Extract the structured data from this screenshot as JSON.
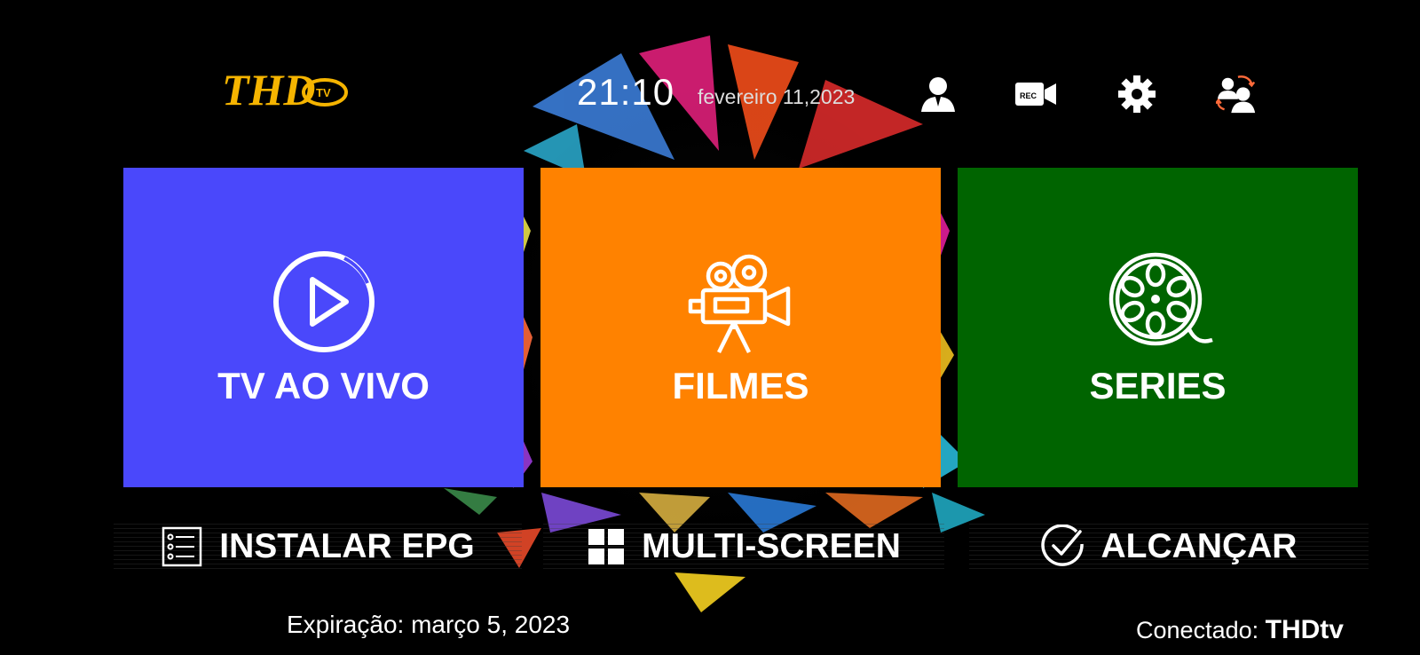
{
  "header": {
    "logo_text": "THD",
    "logo_sub": "TV",
    "time": "21:10",
    "date": "fevereiro 11,2023",
    "icons": [
      "user-icon",
      "rec-camera-icon",
      "gear-icon",
      "switch-user-icon"
    ],
    "rec_label": "REC"
  },
  "tiles": [
    {
      "label": "TV AO VIVO",
      "icon": "play-circle-icon",
      "color": "#4a48fb"
    },
    {
      "label": "FILMES",
      "icon": "movie-camera-icon",
      "color": "#ff8200"
    },
    {
      "label": "SERIES",
      "icon": "film-reel-icon",
      "color": "#006400"
    }
  ],
  "actions": [
    {
      "label": "INSTALAR EPG",
      "icon": "list-icon"
    },
    {
      "label": "MULTI-SCREEN",
      "icon": "grid-icon"
    },
    {
      "label": "ALCANÇAR",
      "icon": "check-circle-icon"
    }
  ],
  "footer": {
    "expiry": "Expiração: março 5, 2023",
    "connected_label": "Conectado:",
    "connected_user": "THDtv"
  },
  "colors": {
    "logo": "#f5b400",
    "background": "#000000"
  }
}
